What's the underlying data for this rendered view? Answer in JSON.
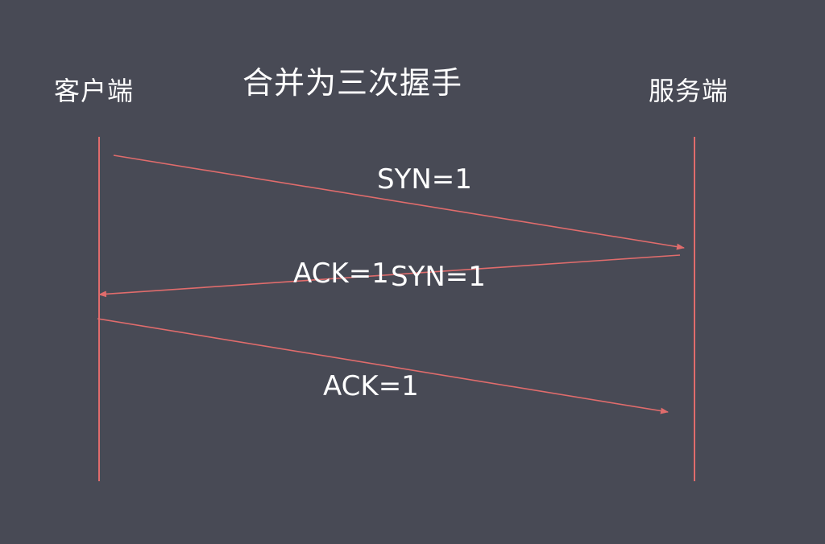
{
  "title": "合并为三次握手",
  "actors": {
    "client": "客户端",
    "server": "服务端"
  },
  "messages": [
    {
      "label": "SYN=1",
      "from": "client",
      "to": "server"
    },
    {
      "label_part1": "ACK=1",
      "label_part2": "SYN=1",
      "from": "server",
      "to": "client"
    },
    {
      "label": "ACK=1",
      "from": "client",
      "to": "server"
    }
  ],
  "colors": {
    "background": "#484a55",
    "line": "#e06c6c",
    "text": "#ffffff"
  }
}
